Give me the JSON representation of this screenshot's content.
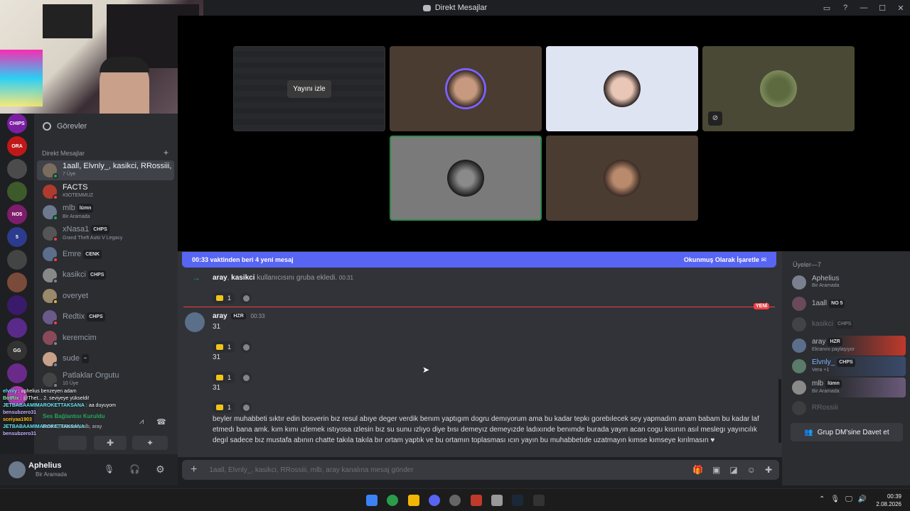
{
  "window": {
    "title": "Direkt Mesajlar"
  },
  "stream_overlay": {
    "watch_label": "Yayını izle",
    "chat_lines": [
      {
        "user": "elvnly",
        "text": "aphelius benzeyen adam",
        "color": "#67e8f9"
      },
      {
        "user": "BotRix",
        "text": "@Thet... 2. seviyeye yükseldi!",
        "color": "#86efac"
      },
      {
        "user": "JETBABAAMIMAROKETTAKSANA",
        "text": "aa duyuyom",
        "color": "#67e8f9"
      },
      {
        "user": "bensubzero31",
        "text": "",
        "color": "#c4b5fd"
      },
      {
        "user": "sceiyaa1903",
        "text": "",
        "color": "#fbbf24"
      },
      {
        "user": "JETBABAAMIMAROKETTAKSANA",
        "text": "",
        "color": "#67e8f9"
      },
      {
        "user": "bensubzero31",
        "text": "",
        "color": "#c4b5fd"
      }
    ]
  },
  "sidebar": {
    "tasks_label": "Görevler",
    "dm_header": "Direkt Mesajlar",
    "add_dm": "+",
    "items": [
      {
        "name": "1aall, Elvnly_, kasikci, RRossiii, ...",
        "sub": "7 Üye",
        "tag": "",
        "active": true
      },
      {
        "name": "FACTS",
        "sub": "#3OTEMMUZ",
        "tag": ""
      },
      {
        "name": "mlb",
        "sub": "Bir Aramada",
        "tag": "lümn"
      },
      {
        "name": "xNasa1",
        "sub": "Grand Theft Auto V Legacy",
        "tag": "CHPS"
      },
      {
        "name": "Emre",
        "sub": "",
        "tag": "CENK"
      },
      {
        "name": "kasikci",
        "sub": "",
        "tag": "CHPS"
      },
      {
        "name": "overyet",
        "sub": "",
        "tag": ""
      },
      {
        "name": "Redtix",
        "sub": "",
        "tag": "CHPS"
      },
      {
        "name": "keremcim",
        "sub": "",
        "tag": ""
      },
      {
        "name": "sude",
        "sub": "",
        "tag": "~"
      },
      {
        "name": "Patlaklar Orgutu",
        "sub": "10 Üye",
        "tag": ""
      }
    ],
    "voice_status": "Ses Bağlantısı Kuruldu",
    "voice_channel": "kasikci, RRossiii, mlb, aray"
  },
  "user_panel": {
    "name": "Aphelius",
    "status": "Bir Aramada"
  },
  "chat": {
    "banner_text": "00:33 vaktinden beri 4 yeni mesaj",
    "banner_action": "Okunmuş Olarak İşaretle",
    "system_msg": {
      "actor": "aray",
      "target": "kasikci",
      "text": "kullanıcısını gruba ekledi.",
      "time": "00:31"
    },
    "new_label": "YENİ",
    "author": {
      "name": "aray",
      "tag": "HZR",
      "time": "00:33"
    },
    "messages": [
      "31",
      "31",
      "31"
    ],
    "long_message": "beyler muhabbeti sıktır edin bosverin bız resul abıye deger verdik benım yaptıgım dogru demıyorum ama bu kadar tepkı gorebılecek sey yapmadım anam babam bu kadar laf etmedı bana amk. kım kımı ızlemek ıstıyosa ızlesin bız su sunu ızlıyo diye bısı demeyız demeyızde ladıxınde benımde burada yayın acan cogu kısının asıl meslegı yayıncılık degıl sadece bız mustafa abının chatte takıla takıla bır ortam yaptık ve bu ortamın toplasması ıcın yayın bu muhabbetıde uzatmayın kımse kımseye kırılmasın ♥",
    "reaction_count": "1",
    "composer_placeholder": "1aall, Elvnly_, kasikci, RRossiii, mlb, aray kanalına mesaj gönder"
  },
  "members": {
    "header": "Üyeler—7",
    "list": [
      {
        "name": "Aphelius",
        "sub": "Bir Aramada",
        "tag": "",
        "dim": false
      },
      {
        "name": "1aall",
        "sub": "",
        "tag": "NO 5",
        "dim": false
      },
      {
        "name": "kasikci",
        "sub": "",
        "tag": "CHPS",
        "dim": true
      },
      {
        "name": "aray",
        "sub": "Ekranını paylaşıyor",
        "tag": "HZR",
        "dim": false
      },
      {
        "name": "Elvnly_",
        "sub": "Vera +1",
        "tag": "CHPS",
        "dim": false
      },
      {
        "name": "mlb",
        "sub": "Bir Aramada",
        "tag": "lümn",
        "dim": false
      },
      {
        "name": "RRossiii",
        "sub": "",
        "tag": "",
        "dim": true
      }
    ],
    "invite_label": "Grup DM'sine Davet et"
  },
  "taskbar": {
    "time": "00:39",
    "date": "2.08.2026"
  }
}
